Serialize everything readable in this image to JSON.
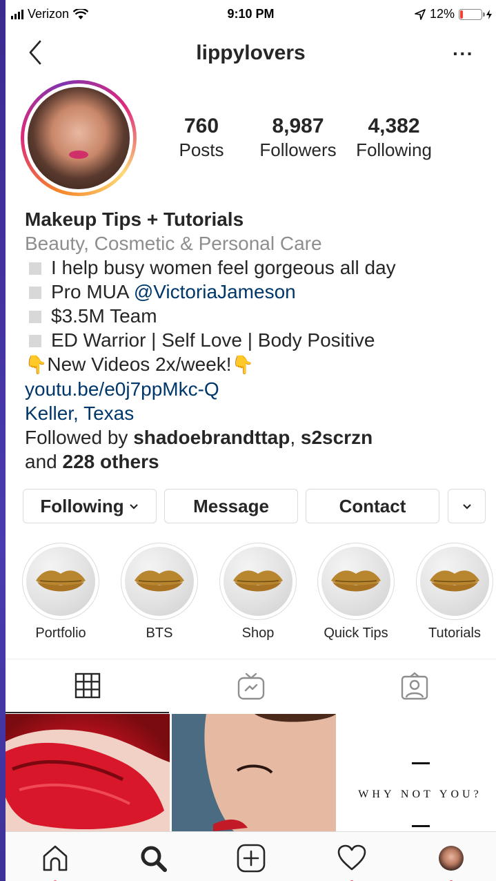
{
  "status_bar": {
    "carrier": "Verizon",
    "time": "9:10 PM",
    "battery": "12%",
    "battery_level": 0.12
  },
  "header": {
    "username": "lippylovers",
    "more_label": "···"
  },
  "profile": {
    "stats": [
      {
        "num": "760",
        "label": "Posts"
      },
      {
        "num": "8,987",
        "label": "Followers"
      },
      {
        "num": "4,382",
        "label": "Following"
      }
    ],
    "name": "Makeup Tips + Tutorials",
    "category": "Beauty, Cosmetic & Personal Care",
    "bio_lines": [
      "I help busy women feel gorgeous all day",
      "Pro MUA ",
      "$3.5M Team",
      "ED Warrior | Self Love | Body Positive"
    ],
    "bio_mention": "@VictoriaJameson",
    "videos_line": "New Videos 2x/week!",
    "website": "youtu.be/e0j7ppMkc-Q",
    "location": "Keller, Texas",
    "followed_by_prefix": "Followed by ",
    "followed_by_users": "shadoebrandttap",
    "followed_by_sep": ", ",
    "followed_by_user2": "s2scrzn",
    "followed_by_and": "and ",
    "followed_by_others": "228 others"
  },
  "buttons": {
    "following": "Following",
    "message": "Message",
    "contact": "Contact"
  },
  "highlights": [
    {
      "label": "Portfolio"
    },
    {
      "label": "BTS"
    },
    {
      "label": "Shop"
    },
    {
      "label": "Quick Tips"
    },
    {
      "label": "Tutorials"
    }
  ],
  "grid": {
    "post3_text": "WHY NOT YOU?"
  },
  "colors": {
    "link": "#00376b",
    "category": "#8e8e8e",
    "notification": "#ed4956",
    "lip_gold": "#b8862e"
  }
}
